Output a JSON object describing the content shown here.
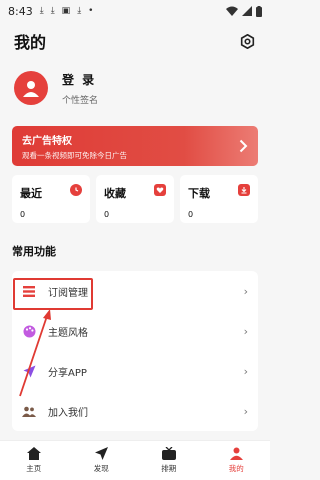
{
  "status_bar": {
    "time": "8:43"
  },
  "header": {
    "title": "我的"
  },
  "profile": {
    "login": "登 录",
    "signature": "个性签名"
  },
  "ad_banner": {
    "title": "去广告特权",
    "subtitle": "观看一条视频即可免除今日广告"
  },
  "stats": [
    {
      "label": "最近",
      "value": "0",
      "icon": "clock-icon"
    },
    {
      "label": "收藏",
      "value": "0",
      "icon": "heart-icon"
    },
    {
      "label": "下载",
      "value": "0",
      "icon": "download-icon"
    }
  ],
  "section": {
    "title": "常用功能"
  },
  "functions": [
    {
      "label": "订阅管理",
      "icon": "list-icon"
    },
    {
      "label": "主题风格",
      "icon": "palette-icon"
    },
    {
      "label": "分享APP",
      "icon": "send-icon"
    },
    {
      "label": "加入我们",
      "icon": "people-icon"
    }
  ],
  "nav": [
    {
      "label": "主页",
      "icon": "home-icon"
    },
    {
      "label": "发现",
      "icon": "navigate-icon"
    },
    {
      "label": "排期",
      "icon": "tv-icon"
    },
    {
      "label": "我的",
      "icon": "person-icon"
    }
  ],
  "colors": {
    "accent": "#e5403c",
    "background": "#f6f6f6"
  }
}
